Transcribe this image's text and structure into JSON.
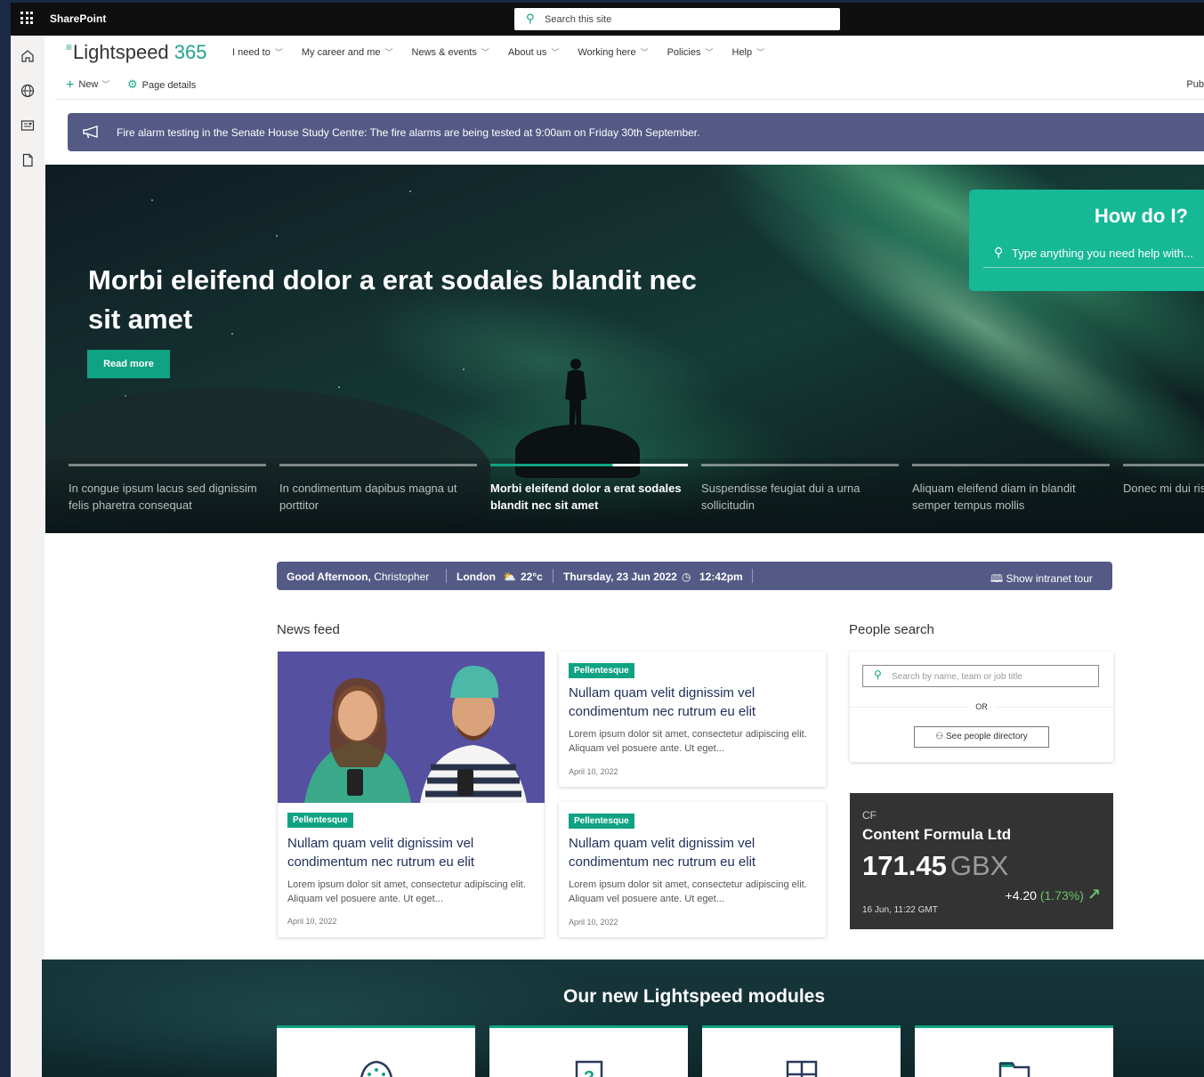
{
  "suite": {
    "brand": "SharePoint",
    "search_placeholder": "Search this site"
  },
  "site": {
    "logo_word": "Lightspeed",
    "logo_num": "365",
    "nav": [
      "I need to",
      "My career and me",
      "News & events",
      "About us",
      "Working here",
      "Policies",
      "Help"
    ]
  },
  "command": {
    "new_label": "New",
    "page_details_label": "Page details",
    "publish_label": "Pub"
  },
  "alert": {
    "text": "Fire alarm testing in the Senate House Study Centre: The fire alarms are being tested at 9:00am on Friday 30th September."
  },
  "hero": {
    "title": "Morbi eleifend dolor a erat sodales blandit nec sit amet",
    "read_more": "Read more",
    "how_do_i": {
      "title": "How do I?",
      "placeholder": "Type anything you need help with..."
    },
    "slides": [
      {
        "label": "In congue ipsum lacus sed dignissim felis pharetra consequat",
        "active": false
      },
      {
        "label": "In condimentum dapibus magna ut porttitor",
        "active": false
      },
      {
        "label": "Morbi eleifend dolor a erat sodales blandit nec sit amet",
        "active": true
      },
      {
        "label": "Suspendisse feugiat dui a urna sollicitudin",
        "active": false
      },
      {
        "label": "Aliquam eleifend diam in blandit semper tempus mollis",
        "active": false
      },
      {
        "label": "Donec mi dui risus eu sceler",
        "active": false
      }
    ],
    "active_progress": 0.62
  },
  "greeting": {
    "salutation": "Good Afternoon,",
    "name": "Christopher",
    "city": "London",
    "temp": "22°c",
    "date": "Thursday, 23 Jun 2022",
    "time": "12:42pm",
    "tour_label": "Show intranet tour"
  },
  "news": {
    "title": "News feed",
    "featured": {
      "tag": "Pellentesque",
      "title": "Nullam quam velit dignissim vel condimentum nec rutrum eu elit",
      "body": "Lorem ipsum dolor sit amet, consectetur adipiscing elit. Aliquam vel posuere ante. Ut eget...",
      "date": "April 10, 2022"
    },
    "items": [
      {
        "tag": "Pellentesque",
        "title": "Nullam quam velit dignissim vel condimentum nec rutrum eu elit",
        "body": "Lorem ipsum dolor sit amet, consectetur adipiscing elit. Aliquam vel posuere ante. Ut eget...",
        "date": "April 10, 2022"
      },
      {
        "tag": "Pellentesque",
        "title": "Nullam quam velit dignissim vel condimentum nec rutrum eu elit",
        "body": "Lorem ipsum dolor sit amet, consectetur adipiscing elit. Aliquam vel posuere ante. Ut eget...",
        "date": "April 10, 2022"
      }
    ]
  },
  "people": {
    "title": "People search",
    "placeholder": "Search by name, team or job title",
    "or_label": "OR",
    "directory_label": "See people directory"
  },
  "stock": {
    "symbol": "CF",
    "name": "Content Formula Ltd",
    "price": "171.45",
    "currency": "GBX",
    "change": "+4.20",
    "change_pct": "(1.73%)",
    "timestamp": "16 Jun, 11:22 GMT"
  },
  "modules": {
    "title": "Our new Lightspeed modules"
  },
  "colors": {
    "accent": "#10a383",
    "banner": "#545a85",
    "suitebar": "#0f0f0f",
    "stock_bg": "#333333"
  }
}
